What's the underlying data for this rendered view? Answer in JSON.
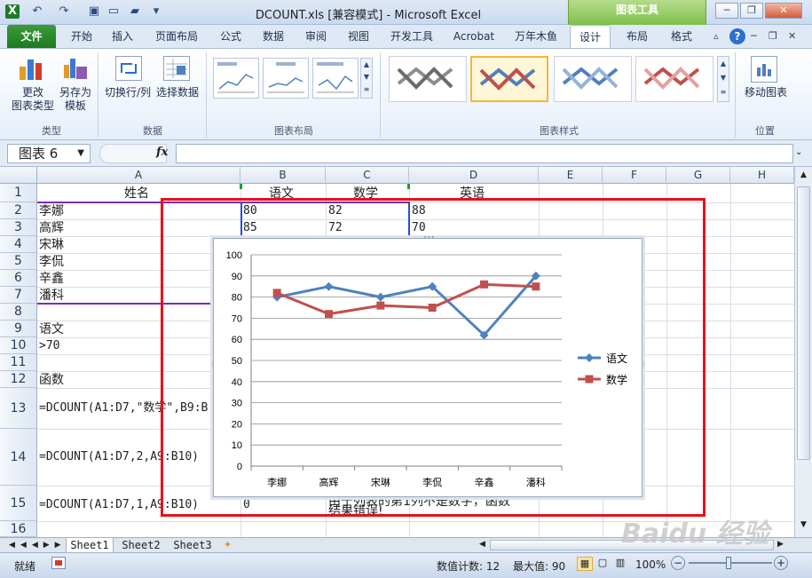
{
  "window": {
    "title": "DCOUNT.xls  [兼容模式]  -  Microsoft Excel",
    "context_tab": "图表工具"
  },
  "tabs": [
    "文件",
    "开始",
    "插入",
    "页面布局",
    "公式",
    "数据",
    "审阅",
    "视图",
    "开发工具",
    "Acrobat",
    "万年木鱼",
    "设计",
    "布局",
    "格式"
  ],
  "ribbon": {
    "change_type_1": "更改",
    "change_type_2": "图表类型",
    "save_template_1": "另存为",
    "save_template_2": "模板",
    "switch_rowcol": "切换行/列",
    "select_data": "选择数据",
    "move_chart": "移动图表",
    "groups": {
      "type": "类型",
      "data": "数据",
      "layout": "图表布局",
      "styles": "图表样式",
      "location": "位置"
    }
  },
  "formula_bar": {
    "name_box": "图表 6",
    "fx": "fx",
    "formula": ""
  },
  "columns": [
    "A",
    "B",
    "C",
    "D",
    "E",
    "F",
    "G",
    "H"
  ],
  "rows": [
    "1",
    "2",
    "3",
    "4",
    "5",
    "6",
    "7",
    "8",
    "9",
    "10",
    "11",
    "12",
    "13",
    "14",
    "15",
    "16"
  ],
  "cells": {
    "A1": "姓名",
    "B1": "语文",
    "C1": "数学",
    "D1": "英语",
    "A2": "李娜",
    "B2": "80",
    "C2": "82",
    "D2": "88",
    "A3": "高辉",
    "B3": "85",
    "C3": "72",
    "D3": "70",
    "A4": "宋琳",
    "A5": "李侃",
    "A6": "辛鑫",
    "A7": "潘科",
    "A9": "语文",
    "A10": ">70",
    "A12": "函数",
    "A13": "=DCOUNT(A1:D7,\"数学\",B9:B",
    "A14": "=DCOUNT(A1:D7,2,A9:B10)",
    "A15": "=DCOUNT(A1:D7,1,A9:B10)",
    "B15": "0",
    "C15a": "由于列表的第1列不是数字，函数",
    "C15b": "结果错误!"
  },
  "sheets": [
    "Sheet1",
    "Sheet2",
    "Sheet3"
  ],
  "status": {
    "ready": "就绪",
    "count": "数值计数: 12",
    "max": "最大值: 90",
    "zoom": "100%"
  },
  "chart_data": {
    "type": "line",
    "categories": [
      "李娜",
      "高辉",
      "宋琳",
      "李侃",
      "辛鑫",
      "潘科"
    ],
    "series": [
      {
        "name": "语文",
        "values": [
          80,
          85,
          80,
          85,
          62,
          90
        ],
        "color": "#4f81bd",
        "marker": "diamond"
      },
      {
        "name": "数学",
        "values": [
          82,
          72,
          76,
          75,
          86,
          85
        ],
        "color": "#c0504d",
        "marker": "square"
      }
    ],
    "ylim": [
      0,
      100
    ],
    "yticks": [
      0,
      10,
      20,
      30,
      40,
      50,
      60,
      70,
      80,
      90,
      100
    ],
    "grid": true,
    "legend": "right"
  },
  "watermark": "Baidu 经验"
}
